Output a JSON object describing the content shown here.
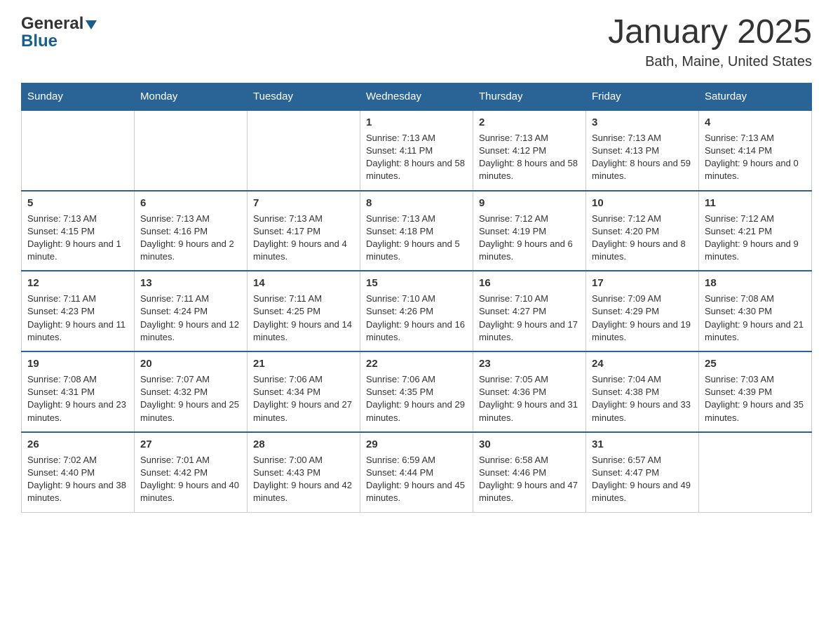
{
  "logo": {
    "line1": "General",
    "line2": "Blue"
  },
  "header": {
    "month_title": "January 2025",
    "location": "Bath, Maine, United States"
  },
  "days_of_week": [
    "Sunday",
    "Monday",
    "Tuesday",
    "Wednesday",
    "Thursday",
    "Friday",
    "Saturday"
  ],
  "weeks": [
    [
      {
        "day": "",
        "sunrise": "",
        "sunset": "",
        "daylight": ""
      },
      {
        "day": "",
        "sunrise": "",
        "sunset": "",
        "daylight": ""
      },
      {
        "day": "",
        "sunrise": "",
        "sunset": "",
        "daylight": ""
      },
      {
        "day": "1",
        "sunrise": "Sunrise: 7:13 AM",
        "sunset": "Sunset: 4:11 PM",
        "daylight": "Daylight: 8 hours and 58 minutes."
      },
      {
        "day": "2",
        "sunrise": "Sunrise: 7:13 AM",
        "sunset": "Sunset: 4:12 PM",
        "daylight": "Daylight: 8 hours and 58 minutes."
      },
      {
        "day": "3",
        "sunrise": "Sunrise: 7:13 AM",
        "sunset": "Sunset: 4:13 PM",
        "daylight": "Daylight: 8 hours and 59 minutes."
      },
      {
        "day": "4",
        "sunrise": "Sunrise: 7:13 AM",
        "sunset": "Sunset: 4:14 PM",
        "daylight": "Daylight: 9 hours and 0 minutes."
      }
    ],
    [
      {
        "day": "5",
        "sunrise": "Sunrise: 7:13 AM",
        "sunset": "Sunset: 4:15 PM",
        "daylight": "Daylight: 9 hours and 1 minute."
      },
      {
        "day": "6",
        "sunrise": "Sunrise: 7:13 AM",
        "sunset": "Sunset: 4:16 PM",
        "daylight": "Daylight: 9 hours and 2 minutes."
      },
      {
        "day": "7",
        "sunrise": "Sunrise: 7:13 AM",
        "sunset": "Sunset: 4:17 PM",
        "daylight": "Daylight: 9 hours and 4 minutes."
      },
      {
        "day": "8",
        "sunrise": "Sunrise: 7:13 AM",
        "sunset": "Sunset: 4:18 PM",
        "daylight": "Daylight: 9 hours and 5 minutes."
      },
      {
        "day": "9",
        "sunrise": "Sunrise: 7:12 AM",
        "sunset": "Sunset: 4:19 PM",
        "daylight": "Daylight: 9 hours and 6 minutes."
      },
      {
        "day": "10",
        "sunrise": "Sunrise: 7:12 AM",
        "sunset": "Sunset: 4:20 PM",
        "daylight": "Daylight: 9 hours and 8 minutes."
      },
      {
        "day": "11",
        "sunrise": "Sunrise: 7:12 AM",
        "sunset": "Sunset: 4:21 PM",
        "daylight": "Daylight: 9 hours and 9 minutes."
      }
    ],
    [
      {
        "day": "12",
        "sunrise": "Sunrise: 7:11 AM",
        "sunset": "Sunset: 4:23 PM",
        "daylight": "Daylight: 9 hours and 11 minutes."
      },
      {
        "day": "13",
        "sunrise": "Sunrise: 7:11 AM",
        "sunset": "Sunset: 4:24 PM",
        "daylight": "Daylight: 9 hours and 12 minutes."
      },
      {
        "day": "14",
        "sunrise": "Sunrise: 7:11 AM",
        "sunset": "Sunset: 4:25 PM",
        "daylight": "Daylight: 9 hours and 14 minutes."
      },
      {
        "day": "15",
        "sunrise": "Sunrise: 7:10 AM",
        "sunset": "Sunset: 4:26 PM",
        "daylight": "Daylight: 9 hours and 16 minutes."
      },
      {
        "day": "16",
        "sunrise": "Sunrise: 7:10 AM",
        "sunset": "Sunset: 4:27 PM",
        "daylight": "Daylight: 9 hours and 17 minutes."
      },
      {
        "day": "17",
        "sunrise": "Sunrise: 7:09 AM",
        "sunset": "Sunset: 4:29 PM",
        "daylight": "Daylight: 9 hours and 19 minutes."
      },
      {
        "day": "18",
        "sunrise": "Sunrise: 7:08 AM",
        "sunset": "Sunset: 4:30 PM",
        "daylight": "Daylight: 9 hours and 21 minutes."
      }
    ],
    [
      {
        "day": "19",
        "sunrise": "Sunrise: 7:08 AM",
        "sunset": "Sunset: 4:31 PM",
        "daylight": "Daylight: 9 hours and 23 minutes."
      },
      {
        "day": "20",
        "sunrise": "Sunrise: 7:07 AM",
        "sunset": "Sunset: 4:32 PM",
        "daylight": "Daylight: 9 hours and 25 minutes."
      },
      {
        "day": "21",
        "sunrise": "Sunrise: 7:06 AM",
        "sunset": "Sunset: 4:34 PM",
        "daylight": "Daylight: 9 hours and 27 minutes."
      },
      {
        "day": "22",
        "sunrise": "Sunrise: 7:06 AM",
        "sunset": "Sunset: 4:35 PM",
        "daylight": "Daylight: 9 hours and 29 minutes."
      },
      {
        "day": "23",
        "sunrise": "Sunrise: 7:05 AM",
        "sunset": "Sunset: 4:36 PM",
        "daylight": "Daylight: 9 hours and 31 minutes."
      },
      {
        "day": "24",
        "sunrise": "Sunrise: 7:04 AM",
        "sunset": "Sunset: 4:38 PM",
        "daylight": "Daylight: 9 hours and 33 minutes."
      },
      {
        "day": "25",
        "sunrise": "Sunrise: 7:03 AM",
        "sunset": "Sunset: 4:39 PM",
        "daylight": "Daylight: 9 hours and 35 minutes."
      }
    ],
    [
      {
        "day": "26",
        "sunrise": "Sunrise: 7:02 AM",
        "sunset": "Sunset: 4:40 PM",
        "daylight": "Daylight: 9 hours and 38 minutes."
      },
      {
        "day": "27",
        "sunrise": "Sunrise: 7:01 AM",
        "sunset": "Sunset: 4:42 PM",
        "daylight": "Daylight: 9 hours and 40 minutes."
      },
      {
        "day": "28",
        "sunrise": "Sunrise: 7:00 AM",
        "sunset": "Sunset: 4:43 PM",
        "daylight": "Daylight: 9 hours and 42 minutes."
      },
      {
        "day": "29",
        "sunrise": "Sunrise: 6:59 AM",
        "sunset": "Sunset: 4:44 PM",
        "daylight": "Daylight: 9 hours and 45 minutes."
      },
      {
        "day": "30",
        "sunrise": "Sunrise: 6:58 AM",
        "sunset": "Sunset: 4:46 PM",
        "daylight": "Daylight: 9 hours and 47 minutes."
      },
      {
        "day": "31",
        "sunrise": "Sunrise: 6:57 AM",
        "sunset": "Sunset: 4:47 PM",
        "daylight": "Daylight: 9 hours and 49 minutes."
      },
      {
        "day": "",
        "sunrise": "",
        "sunset": "",
        "daylight": ""
      }
    ]
  ]
}
